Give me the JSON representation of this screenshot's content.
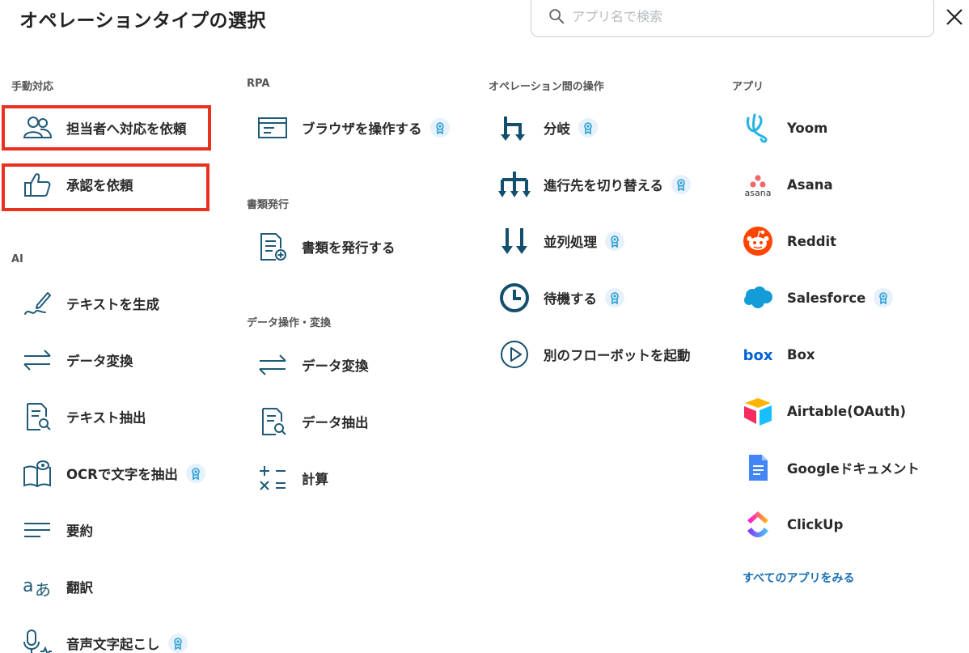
{
  "header": {
    "title": "オペレーションタイプの選択",
    "search_placeholder": "アプリ名で検索"
  },
  "sections": {
    "manual": {
      "label": "手動対応",
      "items": [
        {
          "label": "担当者へ対応を依頼",
          "icon": "people-icon",
          "premium": false
        },
        {
          "label": "承認を依頼",
          "icon": "thumbs-up-icon",
          "premium": false
        }
      ]
    },
    "ai": {
      "label": "AI",
      "items": [
        {
          "label": "テキストを生成",
          "icon": "pen-icon",
          "premium": false
        },
        {
          "label": "データ変換",
          "icon": "swap-arrows-icon",
          "premium": false
        },
        {
          "label": "テキスト抽出",
          "icon": "document-search-icon",
          "premium": false
        },
        {
          "label": "OCRで文字を抽出",
          "icon": "book-eye-icon",
          "premium": true
        },
        {
          "label": "要約",
          "icon": "lines-icon",
          "premium": false
        },
        {
          "label": "翻訳",
          "icon": "translate-icon",
          "premium": false
        },
        {
          "label": "音声文字起こし",
          "icon": "microphone-icon",
          "premium": true
        }
      ]
    },
    "rpa": {
      "label": "RPA",
      "items": [
        {
          "label": "ブラウザを操作する",
          "icon": "browser-icon",
          "premium": true
        }
      ]
    },
    "docs": {
      "label": "書類発行",
      "items": [
        {
          "label": "書類を発行する",
          "icon": "document-add-icon",
          "premium": false
        }
      ]
    },
    "data_ops": {
      "label": "データ操作・変換",
      "items": [
        {
          "label": "データ変換",
          "icon": "swap-arrows-icon",
          "premium": false
        },
        {
          "label": "データ抽出",
          "icon": "document-search-icon",
          "premium": false
        },
        {
          "label": "計算",
          "icon": "calculator-icon",
          "premium": false
        }
      ]
    },
    "ops": {
      "label": "オペレーション間の操作",
      "items": [
        {
          "label": "分岐",
          "icon": "branch-icon",
          "premium": true
        },
        {
          "label": "進行先を切り替える",
          "icon": "switch-path-icon",
          "premium": true
        },
        {
          "label": "並列処理",
          "icon": "parallel-icon",
          "premium": true
        },
        {
          "label": "待機する",
          "icon": "clock-icon",
          "premium": true
        },
        {
          "label": "別のフローボットを起動",
          "icon": "play-circle-icon",
          "premium": false
        }
      ]
    },
    "apps": {
      "label": "アプリ",
      "items": [
        {
          "label": "Yoom",
          "icon": "yoom-logo-icon",
          "premium": false
        },
        {
          "label": "Asana",
          "icon": "asana-logo-icon",
          "premium": false
        },
        {
          "label": "Reddit",
          "icon": "reddit-logo-icon",
          "premium": false
        },
        {
          "label": "Salesforce",
          "icon": "salesforce-logo-icon",
          "premium": true
        },
        {
          "label": "Box",
          "icon": "box-logo-icon",
          "premium": false
        },
        {
          "label": "Airtable(OAuth)",
          "icon": "airtable-logo-icon",
          "premium": false
        },
        {
          "label": "Googleドキュメント",
          "icon": "google-docs-icon",
          "premium": false
        },
        {
          "label": "ClickUp",
          "icon": "clickup-logo-icon",
          "premium": false
        }
      ],
      "more_label": "すべてのアプリをみる"
    }
  },
  "asana_wordmark": "asana",
  "box_wordmark": "box",
  "colors": {
    "icon": "#1f5a78",
    "ops_icon": "#14506e",
    "badge_bg": "#e6f1fb",
    "badge_fg": "#2a9fd6",
    "highlight": "#e8321f",
    "link": "#1a6fb5"
  }
}
